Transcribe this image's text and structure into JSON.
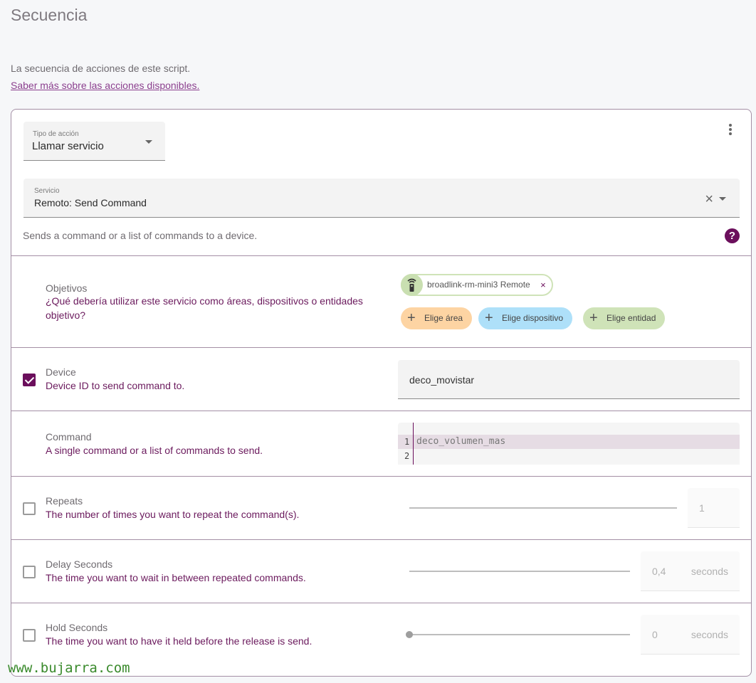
{
  "section": {
    "title": "Secuencia",
    "intro": "La secuencia de acciones de este script.",
    "learn_more_link": "Saber más sobre las acciones disponibles."
  },
  "action": {
    "type_label": "Tipo de acción",
    "type_value": "Llamar servicio",
    "menu_icon": "dots-vertical-icon",
    "service_label": "Servicio",
    "service_value": "Remoto: Send Command",
    "service_description": "Sends a command or a list of commands to a device.",
    "help_icon_glyph": "?"
  },
  "targets": {
    "name": "Objetivos",
    "description": "¿Qué debería utilizar este servicio como áreas, dispositivos o entidades objetivo?",
    "selected_entity": "broadlink-rm-mini3 Remote",
    "remove_glyph": "×",
    "add_area": "Elige área",
    "add_device": "Elige dispositivo",
    "add_entity": "Elige entidad",
    "colors": {
      "area": "#fdd4a3",
      "device": "#aee0f9",
      "entity": "#cfe3b8"
    }
  },
  "fields": {
    "device": {
      "name": "Device",
      "description": "Device ID to send command to.",
      "checked": true,
      "value": "deco_movistar"
    },
    "command": {
      "name": "Command",
      "description": "A single command or a list of commands to send.",
      "lines": [
        {
          "num": "1",
          "text": "deco_volumen_mas"
        },
        {
          "num": "2",
          "text": ""
        }
      ]
    },
    "repeats": {
      "name": "Repeats",
      "description": "The number of times you want to repeat the command(s).",
      "checked": false,
      "value": "1"
    },
    "delay_secs": {
      "name": "Delay Seconds",
      "description": "The time you want to wait in between repeated commands.",
      "checked": false,
      "value": "0,4",
      "unit": "seconds"
    },
    "hold_secs": {
      "name": "Hold Seconds",
      "description": "The time you want to have it held before the release is send.",
      "checked": false,
      "value": "0",
      "unit": "seconds",
      "slider_fraction": 0
    }
  },
  "watermark": "www.bujarra.com",
  "accent_color": "#6b0f5c"
}
